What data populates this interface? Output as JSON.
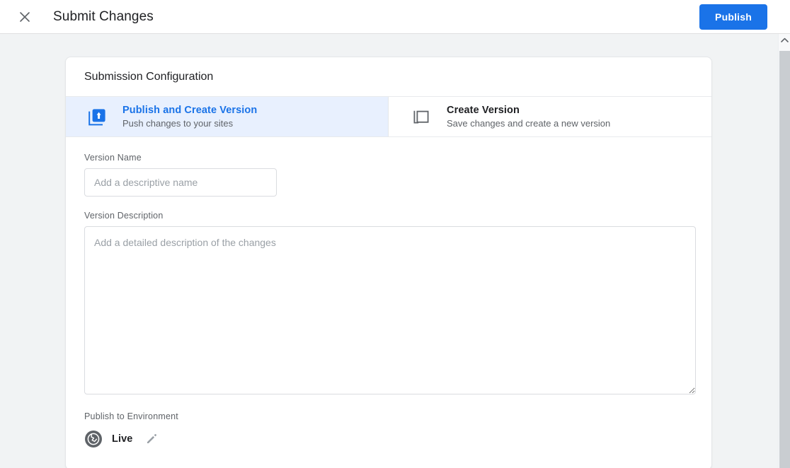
{
  "topbar": {
    "close_icon": "close-icon",
    "title": "Submit Changes",
    "publish_label": "Publish",
    "publish_color": "#1a73e8"
  },
  "card": {
    "header_title": "Submission Configuration",
    "tabs": [
      {
        "icon": "publish-upload-icon",
        "title": "Publish and Create Version",
        "subtitle": "Push changes to your sites",
        "selected": true,
        "selected_bg": "#e8f0fe",
        "selected_fg": "#1a73e8"
      },
      {
        "icon": "copy-version-icon",
        "title": "Create Version",
        "subtitle": "Save changes and create a new version",
        "selected": false
      }
    ],
    "form": {
      "version_name_label": "Version Name",
      "version_name_value": "",
      "version_name_placeholder": "Add a descriptive name",
      "version_description_label": "Version Description",
      "version_description_value": "",
      "version_description_placeholder": "Add a detailed description of the changes"
    },
    "environment": {
      "label": "Publish to Environment",
      "icon": "public-globe-icon",
      "name": "Live",
      "edit_icon": "pencil-edit-icon"
    }
  },
  "scrollbar": {
    "up_arrow_icon": "chevron-up-icon"
  }
}
